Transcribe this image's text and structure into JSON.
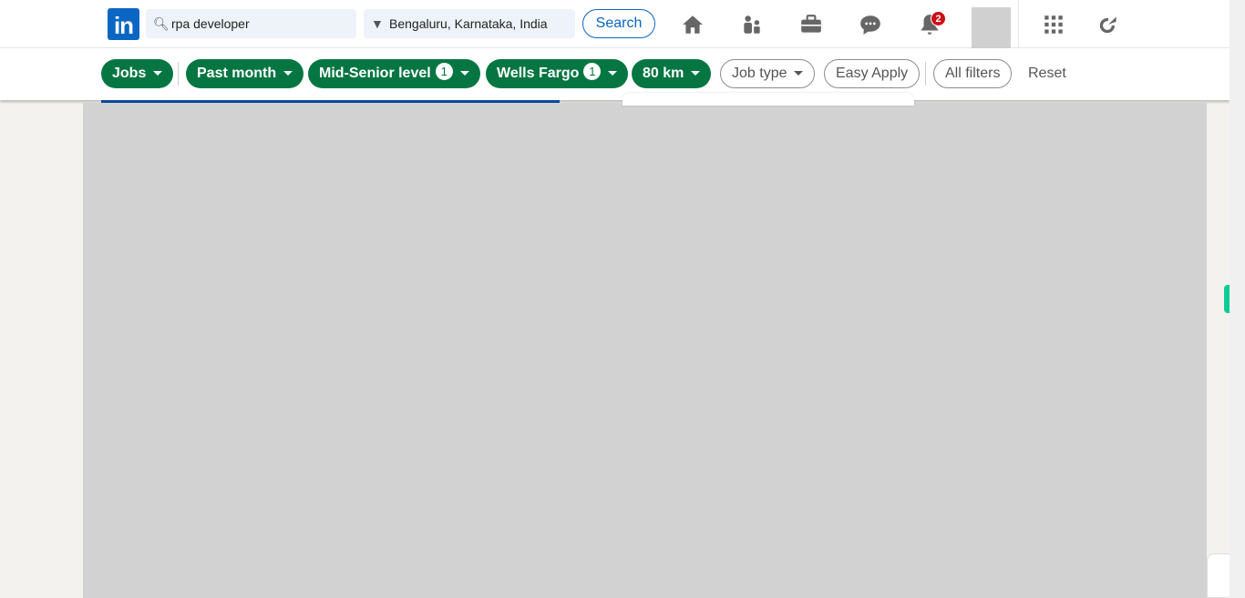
{
  "header": {
    "logo": "in",
    "search_value": "rpa developer",
    "location_value": "Bengaluru, Karnataka, India",
    "search_label": "Search",
    "notifications_count": "2",
    "nav_icons": [
      "home-icon",
      "my-network-icon",
      "jobs-icon",
      "messaging-icon",
      "notifications-icon",
      "apps-grid-icon",
      "premium-icon"
    ]
  },
  "filters": {
    "items": [
      {
        "label": "Jobs",
        "active": true
      },
      {
        "label": "Past month",
        "active": true
      },
      {
        "label": "Mid-Senior level",
        "active": true,
        "count": "1"
      },
      {
        "label": "Wells Fargo",
        "active": true,
        "count": "1"
      },
      {
        "label": "80 km",
        "active": true
      },
      {
        "label": "Job type",
        "active": false
      },
      {
        "label": "Easy Apply",
        "active": false
      },
      {
        "label": "All filters",
        "active": false
      }
    ],
    "reset": "Reset"
  },
  "colors": {
    "brand": "#0a66c2",
    "active_filter": "#057642",
    "notification": "#cc1016"
  }
}
